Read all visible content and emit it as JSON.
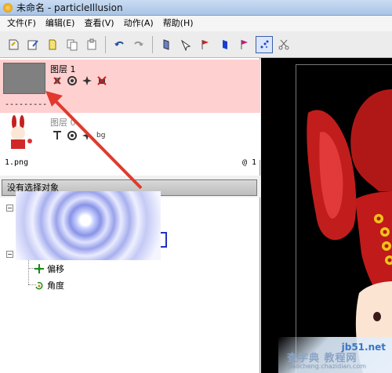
{
  "window": {
    "title": "未命名 - particleIllusion"
  },
  "menu": [
    "文件(F)",
    "编辑(E)",
    "查看(V)",
    "动作(A)",
    "帮助(H)"
  ],
  "toolbar": {
    "icons": [
      "new-emitter-icon",
      "edit-icon",
      "page-icon",
      "copy-icon",
      "paste-icon",
      "undo-icon",
      "redo-icon",
      "deflector-icon",
      "pen-icon",
      "red-flag-icon",
      "blue-shape-icon",
      "magenta-flag-icon",
      "particle-icon",
      "scissors-icon"
    ]
  },
  "layers": {
    "layer1": {
      "name": "图层 1",
      "marker": "---------"
    },
    "layer0": {
      "name": "图层 0",
      "bg_label": "bg",
      "file": "1.png",
      "frame": "@ 1"
    }
  },
  "selection": {
    "header": "没有选择对象"
  },
  "tree": {
    "items": [
      {
        "label": "偏移"
      },
      {
        "label": "角度"
      }
    ]
  },
  "watermark": {
    "site": "jb51.net",
    "cn": "查字典 教程网",
    "url": "jiaocheng.chazidian.com"
  },
  "colors": {
    "layer_selected_bg": "#ffd0d0",
    "arrow": "#e03a2e",
    "canvas_bg": "#000000"
  }
}
